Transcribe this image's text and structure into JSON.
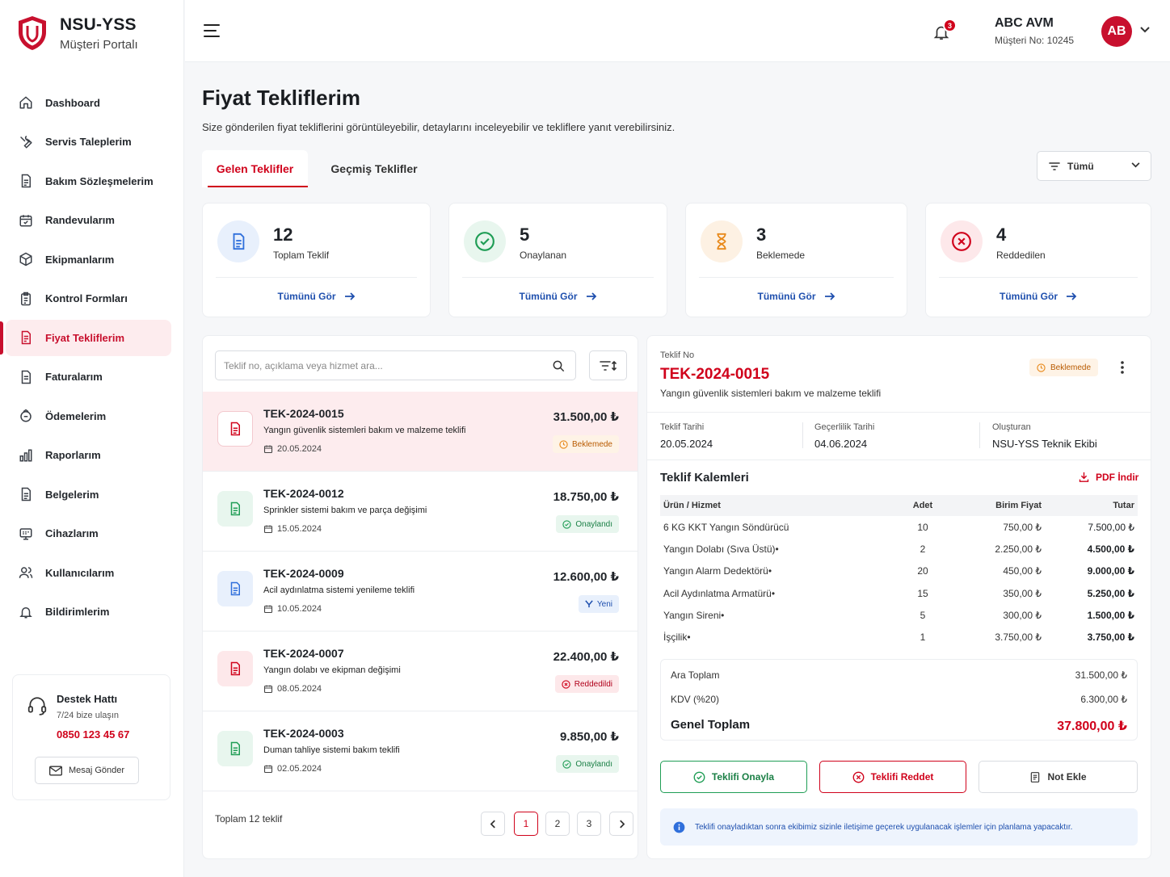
{
  "brand": {
    "title": "NSU-YSS",
    "subtitle": "Müşteri Portalı",
    "accent": "#c8102e"
  },
  "sidebar": {
    "items": [
      {
        "label": "Dashboard",
        "icon": "home-icon"
      },
      {
        "label": "Servis Taleplerim",
        "icon": "wrench-icon"
      },
      {
        "label": "Bakım Sözleşmelerim",
        "icon": "document-icon"
      },
      {
        "label": "Randevularım",
        "icon": "calendar-icon"
      },
      {
        "label": "Ekipmanlarım",
        "icon": "box-icon"
      },
      {
        "label": "Kontrol Formları",
        "icon": "clipboard-icon"
      },
      {
        "label": "Fiyat Tekliflerim",
        "icon": "quote-document-icon",
        "active": true
      },
      {
        "label": "Faturalarım",
        "icon": "invoice-icon"
      },
      {
        "label": "Ödemelerim",
        "icon": "wallet-icon"
      },
      {
        "label": "Raporlarım",
        "icon": "bar-chart-icon"
      },
      {
        "label": "Belgelerim",
        "icon": "file-icon"
      },
      {
        "label": "Cihazlarım",
        "icon": "device-icon"
      },
      {
        "label": "Kullanıcılarım",
        "icon": "users-icon"
      },
      {
        "label": "Bildirimlerim",
        "icon": "bell-icon"
      }
    ]
  },
  "support": {
    "title": "Destek Hattı",
    "subtitle": "7/24 bize ulaşın",
    "phone": "0850 123 45 67",
    "button": "Mesaj Gönder"
  },
  "header": {
    "notification_count": "3",
    "company": "ABC AVM",
    "customer_no": "Müşteri No: 10245",
    "avatar_initials": "AB"
  },
  "page": {
    "title": "Fiyat Tekliflerim",
    "description": "Size gönderilen fiyat tekliflerini görüntüleyebilir, detaylarını inceleyebilir ve tekliflere yanıt verebilirsiniz.",
    "tabs": [
      {
        "label": "Gelen Teklifler",
        "active": true
      },
      {
        "label": "Geçmiş Teklifler"
      }
    ],
    "filter": "Tümü"
  },
  "stats": [
    {
      "value": "12",
      "label": "Toplam Teklif",
      "link": "Tümünü Gör",
      "color": "#2f6fdb"
    },
    {
      "value": "5",
      "label": "Onaylanan",
      "link": "Tümünü Gör",
      "color": "#1f9d55"
    },
    {
      "value": "3",
      "label": "Beklemede",
      "link": "Tümünü Gör",
      "color": "#e8891a"
    },
    {
      "value": "4",
      "label": "Reddedilen",
      "link": "Tümünü Gör",
      "color": "#d0021b"
    }
  ],
  "list": {
    "search_placeholder": "Teklif no, açıklama veya hizmet ara...",
    "quotes": [
      {
        "no": "TEK-2024-0015",
        "desc": "Yangın güvenlik sistemleri bakım ve malzeme teklifi",
        "date": "20.05.2024",
        "amount": "31.500,00 ₺",
        "status": "Beklemede",
        "kind": "pending"
      },
      {
        "no": "TEK-2024-0012",
        "desc": "Sprinkler sistemi bakım ve parça değişimi",
        "date": "15.05.2024",
        "amount": "18.750,00 ₺",
        "status": "Onaylandı",
        "kind": "approved"
      },
      {
        "no": "TEK-2024-0009",
        "desc": "Acil aydınlatma sistemi yenileme teklifi",
        "date": "10.05.2024",
        "amount": "12.600,00 ₺",
        "status": "Yeni",
        "kind": "new"
      },
      {
        "no": "TEK-2024-0007",
        "desc": "Yangın dolabı ve ekipman değişimi",
        "date": "08.05.2024",
        "amount": "22.400,00 ₺",
        "status": "Reddedildi",
        "kind": "rejected"
      },
      {
        "no": "TEK-2024-0003",
        "desc": "Duman tahliye sistemi bakım teklifi",
        "date": "02.05.2024",
        "amount": "9.850,00 ₺",
        "status": "Onaylandı",
        "kind": "approved"
      }
    ],
    "total_text": "Toplam 12 teklif",
    "pages": [
      "1",
      "2",
      "3"
    ]
  },
  "detail": {
    "label": "Teklif No",
    "no": "TEK-2024-0015",
    "desc": "Yangın güvenlik sistemleri bakım ve malzeme teklifi",
    "status": "Beklemede",
    "meta": [
      {
        "k": "Teklif Tarihi",
        "v": "20.05.2024"
      },
      {
        "k": "Geçerlilik Tarihi",
        "v": "04.06.2024"
      },
      {
        "k": "Oluşturan",
        "v": "NSU-YSS Teknik Ekibi"
      }
    ],
    "items_title": "Teklif Kalemleri",
    "pdf_label": "PDF İndir",
    "columns": [
      "Ürün / Hizmet",
      "Adet",
      "Birim Fiyat",
      "Tutar"
    ],
    "rows": [
      {
        "name": "6 KG KKT Yangın Söndürücü",
        "qty": "10",
        "unit": "750,00 ₺",
        "total": "7.500,00 ₺"
      },
      {
        "name": "Yangın Dolabı (Sıva Üstü)•",
        "qty": "2",
        "unit": "2.250,00 ₺",
        "total": "4.500,00 ₺"
      },
      {
        "name": "Yangın Alarm Dedektörü•",
        "qty": "20",
        "unit": "450,00 ₺",
        "total": "9.000,00 ₺"
      },
      {
        "name": "Acil Aydınlatma Armatürü•",
        "qty": "15",
        "unit": "350,00 ₺",
        "total": "5.250,00 ₺"
      },
      {
        "name": "Yangın Sireni•",
        "qty": "5",
        "unit": "300,00 ₺",
        "total": "1.500,00 ₺"
      },
      {
        "name": "İşçilik•",
        "qty": "1",
        "unit": "3.750,00 ₺",
        "total": "3.750,00 ₺"
      }
    ],
    "subtotal_label": "Ara Toplam",
    "subtotal": "31.500,00 ₺",
    "vat_label": "KDV (%20)",
    "vat": "6.300,00 ₺",
    "grand_label": "Genel Toplam",
    "grand": "37.800,00 ₺",
    "approve": "Teklifi Onayla",
    "reject": "Teklifi Reddet",
    "note": "Not Ekle",
    "info": "Teklifi onayladıktan sonra ekibimiz sizinle iletişime geçerek uygulanacak işlemler için planlama yapacaktır."
  }
}
